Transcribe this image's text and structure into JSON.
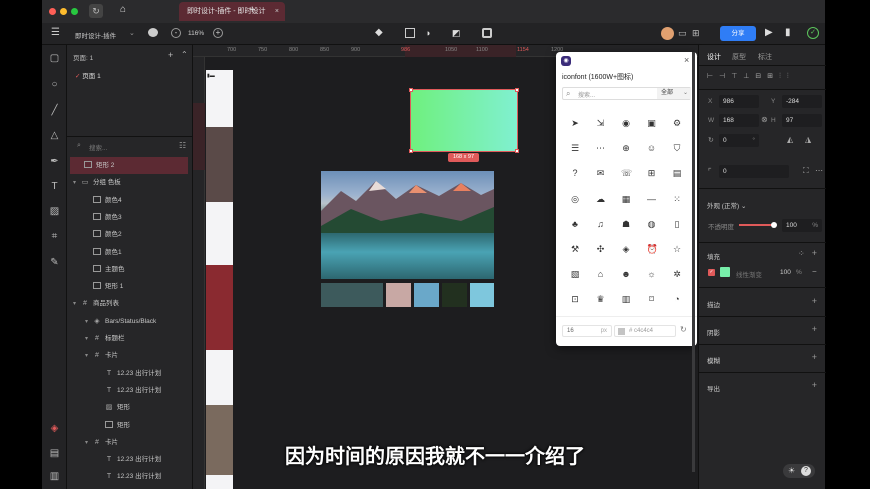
{
  "tab": {
    "title": "即时设计-插件 - 即时设计",
    "new_tab": "+"
  },
  "toolbar": {
    "doc_title": "即时设计-插件",
    "zoom": "116%",
    "share_label": "分享"
  },
  "layers_panel": {
    "pages_label": "页面: 1",
    "page_name": "页面 1",
    "search_placeholder": "搜索...",
    "items": [
      {
        "label": "矩形 2",
        "indent": 0,
        "icon": "rect"
      },
      {
        "label": "分组 色板",
        "indent": 0,
        "icon": "folder"
      },
      {
        "label": "颜色4",
        "indent": 1,
        "icon": "rect"
      },
      {
        "label": "颜色3",
        "indent": 1,
        "icon": "rect"
      },
      {
        "label": "颜色2",
        "indent": 1,
        "icon": "rect"
      },
      {
        "label": "颜色1",
        "indent": 1,
        "icon": "rect"
      },
      {
        "label": "主题色",
        "indent": 1,
        "icon": "rect"
      },
      {
        "label": "矩形 1",
        "indent": 1,
        "icon": "rect"
      },
      {
        "label": "商品列表",
        "indent": 0,
        "icon": "frame"
      },
      {
        "label": "Bars/Status/Black",
        "indent": 1,
        "icon": "component"
      },
      {
        "label": "标题栏",
        "indent": 1,
        "icon": "frame"
      },
      {
        "label": "卡片",
        "indent": 1,
        "icon": "frame"
      },
      {
        "label": "12.23 出行计划",
        "indent": 2,
        "icon": "text"
      },
      {
        "label": "12.23 出行计划",
        "indent": 2,
        "icon": "text"
      },
      {
        "label": "矩形",
        "indent": 2,
        "icon": "image"
      },
      {
        "label": "矩形",
        "indent": 2,
        "icon": "rect"
      },
      {
        "label": "卡片",
        "indent": 1,
        "icon": "frame"
      },
      {
        "label": "12.23 出行计划",
        "indent": 2,
        "icon": "text"
      },
      {
        "label": "12.23 出行计划",
        "indent": 2,
        "icon": "text"
      }
    ]
  },
  "ruler": {
    "ticks": [
      "700",
      "750",
      "800",
      "850",
      "900",
      "986",
      "1050",
      "1100",
      "1154",
      "1200"
    ]
  },
  "canvas": {
    "size_badge": "168 x 97",
    "swatch_colors": [
      "#3d5a5c",
      "#c8a8a4",
      "#6aa8c9",
      "#22301f",
      "#7ec7dd"
    ]
  },
  "iconfont": {
    "title": "iconfont (1600W+图标)",
    "search_placeholder": "搜索...",
    "filter": "全部",
    "size_value": "16",
    "size_unit": "px",
    "color_value": "# c4c4c4",
    "icons": [
      [
        "send-icon",
        "import-icon",
        "eye-icon",
        "save-icon",
        "settings-icon"
      ],
      [
        "document-icon",
        "more-icon",
        "add-circle-icon",
        "user-icon",
        "shield-icon"
      ],
      [
        "help-icon",
        "chat-icon",
        "phone-icon",
        "apps-icon",
        "list-icon"
      ],
      [
        "target-icon",
        "cloud-icon",
        "box-icon",
        "minus-icon",
        "grid-dots-icon"
      ],
      [
        "game-icon",
        "bell-icon",
        "toy-icon",
        "apple-icon",
        "tablet-icon"
      ],
      [
        "tool-icon",
        "drone-icon",
        "shapes-icon",
        "alarm-icon",
        "star-icon"
      ],
      [
        "photo-icon",
        "cake-icon",
        "robot-icon",
        "sun-icon",
        "gear-icon"
      ],
      [
        "save-box-icon",
        "crown-icon",
        "building-icon",
        "tag-icon",
        "clock-icon"
      ]
    ]
  },
  "right_panel": {
    "tabs": [
      "设计",
      "原型",
      "标注"
    ],
    "x_label": "X",
    "x_value": "986",
    "y_label": "Y",
    "y_value": "-284",
    "w_label": "W",
    "w_value": "168",
    "h_label": "H",
    "h_value": "97",
    "rotation": "0",
    "rotation_unit": "°",
    "corner": "0",
    "appearance_label": "外观 (正常)",
    "opacity_label": "不透明度",
    "opacity_value": "100",
    "opacity_unit": "%",
    "fill_label": "填充",
    "fill_type": "线性渐变",
    "fill_opacity": "100",
    "fill_unit": "%",
    "stroke_label": "描边",
    "shadow_label": "阴影",
    "blur_label": "模糊",
    "export_label": "导出"
  },
  "subtitle": "因为时间的原因我就不一一介绍了"
}
